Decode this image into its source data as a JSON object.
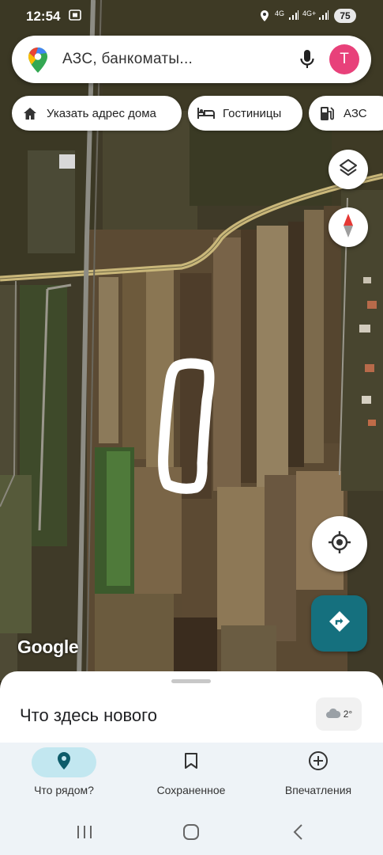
{
  "status_bar": {
    "time": "12:54",
    "network_1": "4G",
    "network_2": "4G+",
    "battery": "75"
  },
  "search": {
    "placeholder": "АЗС, банкоматы...",
    "avatar_letter": "T"
  },
  "chips": [
    {
      "label": "Указать адрес дома",
      "icon": "home-icon"
    },
    {
      "label": "Гостиницы",
      "icon": "hotel-icon"
    },
    {
      "label": "АЗС",
      "icon": "gas-station-icon"
    }
  ],
  "map": {
    "attribution": "Google",
    "layers_icon": "layers-icon",
    "compass_icon": "compass-icon",
    "location_icon": "my-location-icon",
    "directions_icon": "directions-icon"
  },
  "sheet": {
    "title": "Что здесь нового",
    "weather_temp": "2°"
  },
  "bottom_nav": [
    {
      "label": "Что рядом?",
      "icon": "place-pin-icon",
      "active": true
    },
    {
      "label": "Сохраненное",
      "icon": "bookmark-icon",
      "active": false
    },
    {
      "label": "Впечатления",
      "icon": "add-circle-icon",
      "active": false
    }
  ],
  "colors": {
    "accent": "#15707e",
    "avatar": "#e8417a",
    "active_pill": "#c2e7f0"
  }
}
